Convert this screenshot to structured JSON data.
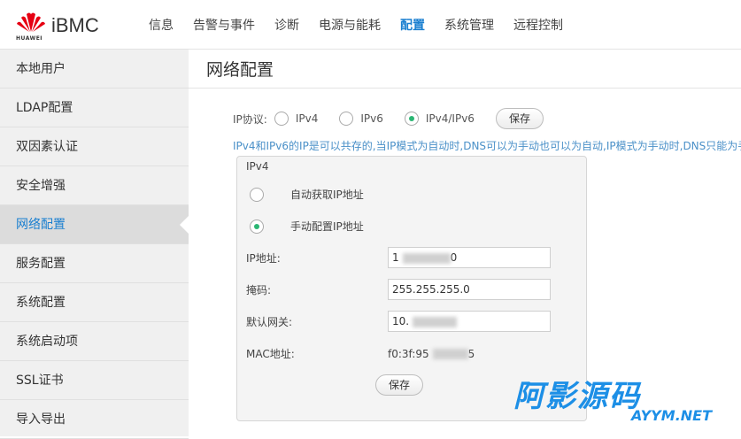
{
  "app": {
    "brand_small": "HUAWEI",
    "product": "iBMC"
  },
  "nav": {
    "items": [
      "信息",
      "告警与事件",
      "诊断",
      "电源与能耗",
      "配置",
      "系统管理",
      "远程控制"
    ],
    "active_index": 4
  },
  "sidebar": {
    "items": [
      "本地用户",
      "LDAP配置",
      "双因素认证",
      "安全增强",
      "网络配置",
      "服务配置",
      "系统配置",
      "系统启动项",
      "SSL证书",
      "导入导出"
    ],
    "active_index": 4
  },
  "page": {
    "title": "网络配置"
  },
  "protocol": {
    "label": "IP协议:",
    "options": [
      "IPv4",
      "IPv6",
      "IPv4/IPv6"
    ],
    "selected": "IPv4/IPv6",
    "save_label": "保存"
  },
  "hint": "IPv4和IPv6的IP是可以共存的,当IP模式为自动时,DNS可以为手动也可以为自动,IP模式为手动时,DNS只能为手",
  "ipv4": {
    "title": "IPv4",
    "auto_label": "自动获取IP地址",
    "manual_label": "手动配置IP地址",
    "mode": "manual",
    "ip_label": "IP地址:",
    "ip_value_visible_start": "1",
    "ip_value_visible_end": "0",
    "mask_label": "掩码:",
    "mask_value": "255.255.255.0",
    "gateway_label": "默认网关:",
    "gateway_value_visible_start": "10.",
    "mac_label": "MAC地址:",
    "mac_value_visible_start": "f0:3f:95",
    "mac_value_visible_end": "5",
    "save_label": "保存"
  },
  "watermark": {
    "main": "阿影源码",
    "sub": "AYYM.NET"
  },
  "colors": {
    "accent": "#1a7fd0",
    "radio_checked": "#2bb673",
    "hint": "#4a90c8",
    "watermark": "#1d8fe6"
  }
}
